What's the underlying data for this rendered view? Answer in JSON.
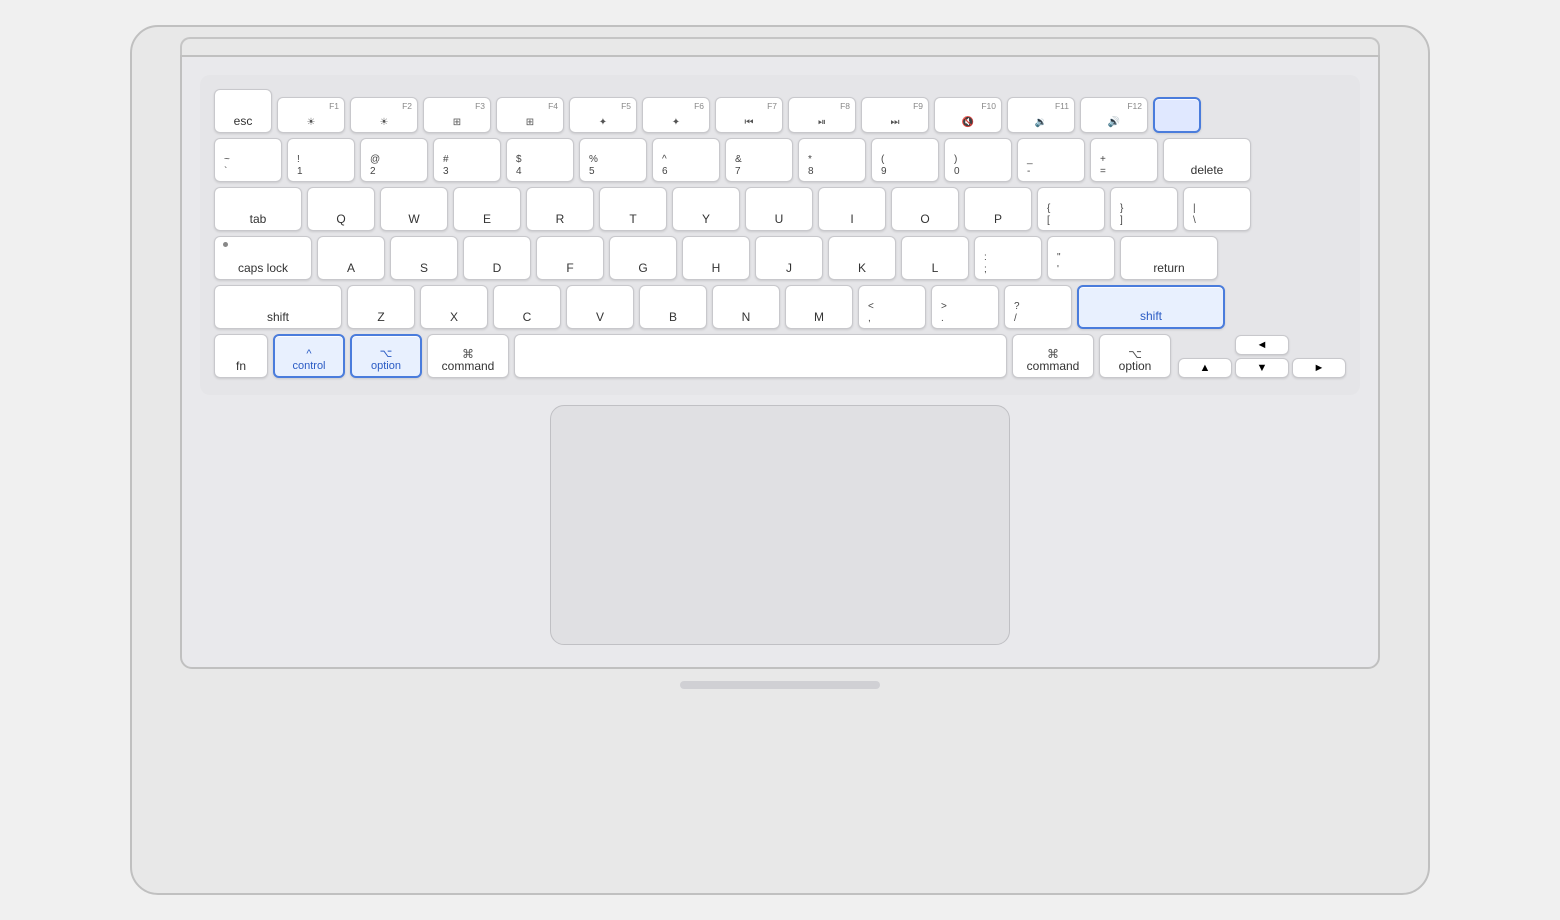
{
  "laptop": {
    "keys": {
      "esc": "esc",
      "tab": "tab",
      "caps_lock": "caps lock",
      "shift_l": "shift",
      "shift_r": "shift",
      "fn": "fn",
      "control": "control",
      "option_l": "option",
      "command_l": "command",
      "command_r": "command",
      "option_r": "option",
      "delete": "delete",
      "return": "return"
    },
    "highlighted": {
      "control_label": "control",
      "option_l_label": "option",
      "shift_r_label": "shift",
      "power_label": ""
    }
  }
}
